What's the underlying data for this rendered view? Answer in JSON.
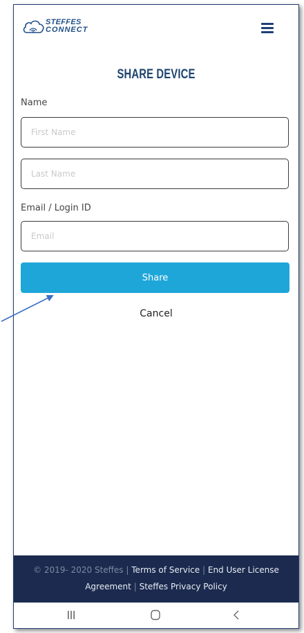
{
  "brand": {
    "line1": "STEFFES",
    "line2": "CONNECT",
    "accent": "#1e4f86"
  },
  "header": {
    "menu_icon": "hamburger-menu-icon"
  },
  "page": {
    "title": "SHARE DEVICE"
  },
  "form": {
    "name_label": "Name",
    "first_name": {
      "value": "",
      "placeholder": "First Name"
    },
    "last_name": {
      "value": "",
      "placeholder": "Last Name"
    },
    "email_label": "Email / Login ID",
    "email": {
      "value": "",
      "placeholder": "Email"
    },
    "share_label": "Share",
    "cancel_label": "Cancel",
    "share_color": "#1fa6d9"
  },
  "footer": {
    "copyright": "© 2019- 2020 Steffes",
    "sep": "|",
    "terms": "Terms of Service",
    "eula_line1": "End User License",
    "eula_line2": "Agreement",
    "privacy": "Steffes Privacy Policy",
    "background": "#1b2a4e"
  },
  "system_nav": {
    "recents_icon": "recents-icon",
    "home_icon": "home-icon",
    "back_icon": "back-icon"
  }
}
